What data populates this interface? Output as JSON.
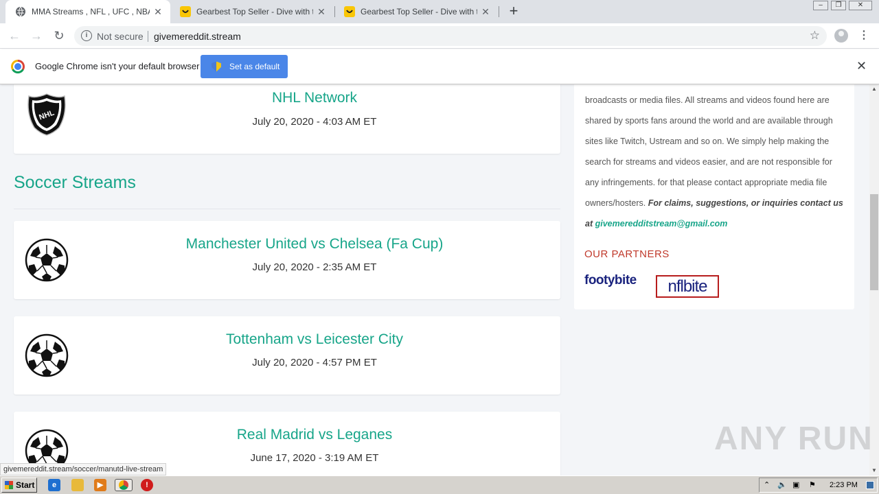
{
  "browser": {
    "tabs": [
      {
        "title": "MMA Streams , NFL , UFC , NBA , Boxing",
        "icon": "globe-icon",
        "active": true
      },
      {
        "title": "Gearbest Top Seller - Dive with the Ocean",
        "icon": "gearbest-icon",
        "active": false
      },
      {
        "title": "Gearbest Top Seller - Dive with the Ocean",
        "icon": "gearbest-icon",
        "active": false
      }
    ],
    "new_tab": "+",
    "security_label": "Not secure",
    "url": "givemereddit.stream",
    "infobar": {
      "message": "Google Chrome isn't your default browser",
      "button": "Set as default"
    },
    "status_url": "givemereddit.stream/soccer/manutd-live-stream"
  },
  "page": {
    "top_card": {
      "title": "NHL Network",
      "time": "July 20, 2020 - 4:03 AM ET",
      "icon": "nhl-logo"
    },
    "section_title": "Soccer Streams",
    "matches": [
      {
        "title": "Manchester United vs Chelsea (Fa Cup)",
        "time": "July 20, 2020 - 2:35 AM ET",
        "icon": "soccer-ball-icon"
      },
      {
        "title": "Tottenham vs Leicester City",
        "time": "July 20, 2020 - 4:57 PM ET",
        "icon": "soccer-ball-icon"
      },
      {
        "title": "Real Madrid vs Leganes",
        "time": "June 17, 2020 - 3:19 AM ET",
        "icon": "soccer-ball-icon"
      }
    ],
    "sidebar": {
      "disclaimer_lines": [
        "broadcasts or media files. All streams and videos found here are",
        "shared by sports fans around the world and are available through",
        "sites like Twitch, Ustream and so on. We simply help making the",
        "search for streams and videos easier, and are not responsible for",
        "any infringements. for that please contact appropriate media file",
        "owners/hosters."
      ],
      "claims_text": "For claims, suggestions, or inquiries contact us at",
      "email": "givemeredditstream@gmail.com",
      "partners_heading": "OUR PARTNERS",
      "partners": [
        "footybite",
        "nflbite"
      ]
    }
  },
  "watermark": "ANY RUN",
  "taskbar": {
    "start": "Start",
    "clock": "2:23 PM"
  },
  "colors": {
    "accent": "#17a589",
    "partners_heading": "#c0392b",
    "chrome_button": "#4a86e8"
  }
}
